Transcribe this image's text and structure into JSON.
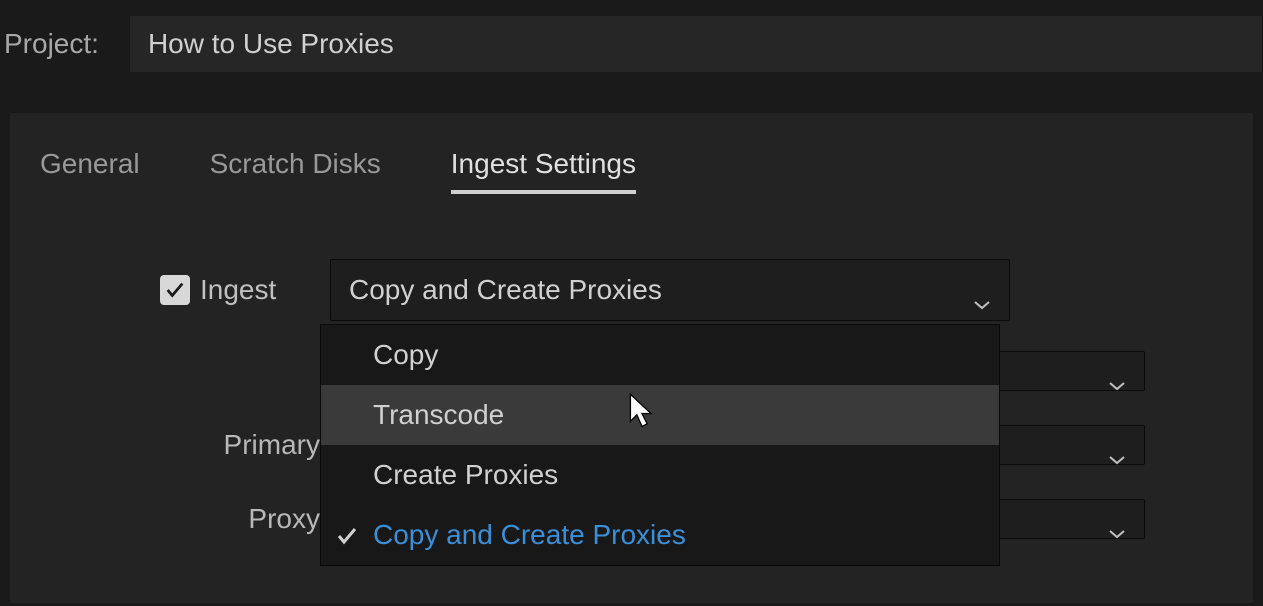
{
  "header": {
    "project_label": "Project:",
    "project_name": "How to Use Proxies"
  },
  "tabs": {
    "general": "General",
    "scratch_disks": "Scratch Disks",
    "ingest_settings": "Ingest Settings"
  },
  "settings": {
    "ingest_checkbox_label": "Ingest",
    "ingest_checked": true,
    "ingest_dropdown_value": "Copy and Create Proxies",
    "primary_label": "Primary",
    "proxy_label": "Proxy"
  },
  "dropdown_options": {
    "copy": "Copy",
    "transcode": "Transcode",
    "create_proxies": "Create Proxies",
    "copy_create_proxies": "Copy and Create Proxies"
  }
}
